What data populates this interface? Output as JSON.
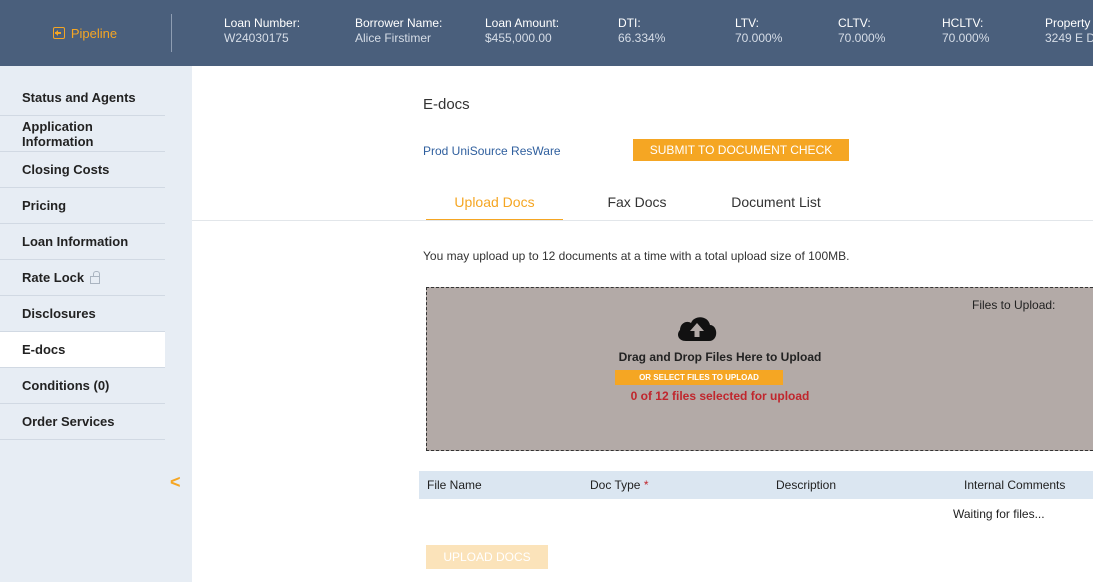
{
  "header": {
    "pipeline_label": "Pipeline",
    "fields": [
      {
        "label": "Loan Number:",
        "value": "W24030175"
      },
      {
        "label": "Borrower Name:",
        "value": "Alice Firstimer"
      },
      {
        "label": "Loan Amount:",
        "value": "$455,000.00"
      },
      {
        "label": "DTI:",
        "value": "66.334%"
      },
      {
        "label": "LTV:",
        "value": "70.000%"
      },
      {
        "label": "CLTV:",
        "value": "70.000%"
      },
      {
        "label": "HCLTV:",
        "value": "70.000%"
      },
      {
        "label": "Property",
        "value": "3249 E D"
      }
    ]
  },
  "sidebar": {
    "items": [
      {
        "label": "Status and Agents"
      },
      {
        "label": "Application Information"
      },
      {
        "label": "Closing Costs"
      },
      {
        "label": "Pricing"
      },
      {
        "label": "Loan Information"
      },
      {
        "label": "Rate Lock"
      },
      {
        "label": "Disclosures"
      },
      {
        "label": "E-docs"
      },
      {
        "label": "Conditions (0)"
      },
      {
        "label": "Order Services"
      }
    ],
    "active": "E-docs",
    "collapse_glyph": "<"
  },
  "main": {
    "title": "E-docs",
    "provider": "Prod UniSource ResWare",
    "submit_label": "SUBMIT TO DOCUMENT CHECK",
    "tabs": [
      {
        "label": "Upload Docs"
      },
      {
        "label": "Fax Docs"
      },
      {
        "label": "Document List"
      }
    ],
    "active_tab": "Upload Docs",
    "upload_note": "You may upload up to 12 documents at a time with a total upload size of 100MB.",
    "dropzone": {
      "files_to_upload": "Files to Upload:",
      "title": "Drag and Drop Files Here to Upload",
      "select_label": "OR SELECT FILES TO UPLOAD",
      "count_text": "0 of 12 files selected for upload"
    },
    "table": {
      "columns": [
        {
          "label": "File Name",
          "required": ""
        },
        {
          "label": "Doc Type",
          "required": "*"
        },
        {
          "label": "Description",
          "required": ""
        },
        {
          "label": "Internal Comments",
          "required": ""
        }
      ],
      "empty_text": "Waiting for files..."
    },
    "upload_label": "UPLOAD DOCS"
  },
  "colors": {
    "header_bg": "#4a5f7c",
    "accent": "#f5a623",
    "sidebar_bg": "#e7edf4",
    "dropzone_bg": "#b3aaa7",
    "error": "#c0262d",
    "link": "#2f5f9e"
  }
}
